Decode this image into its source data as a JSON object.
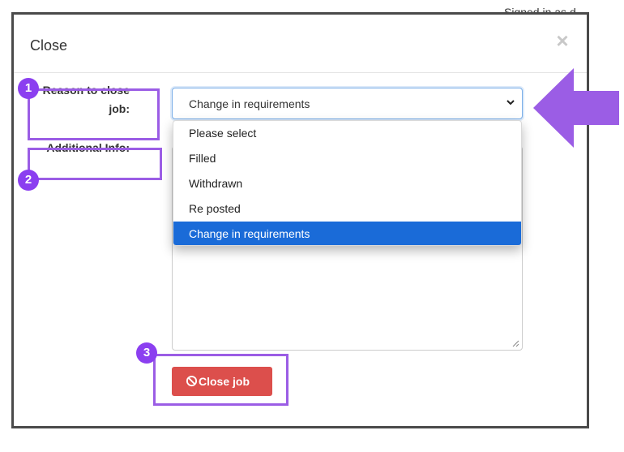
{
  "background": {
    "signed_in_text": "Signed in as d"
  },
  "modal": {
    "title": "Close",
    "close_symbol": "×",
    "reason_label": "Reason to close job:",
    "additional_info_label": "Additional Info:",
    "select": {
      "value": "Change in requirements",
      "options": [
        "Please select",
        "Filled",
        "Withdrawn",
        "Re posted",
        "Change in requirements"
      ],
      "selected_index": 4
    },
    "button": {
      "label": "Close job",
      "icon": "ban-icon",
      "color": "#dc4f4c"
    }
  },
  "annotations": {
    "badges": [
      "1",
      "2",
      "3"
    ],
    "highlight_color": "#9b5de5",
    "badge_color": "#8b3ff0",
    "arrow_color": "#9b5de5"
  }
}
